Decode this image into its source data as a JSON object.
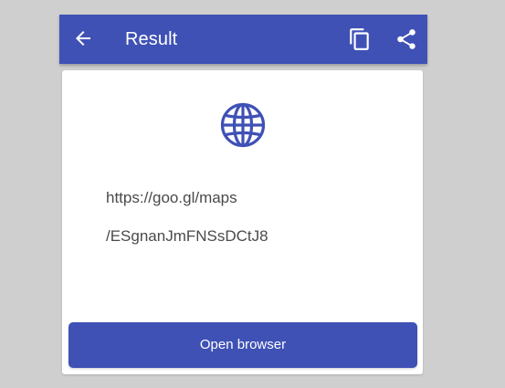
{
  "appbar": {
    "title": "Result",
    "back_icon": "arrow-back-icon",
    "copy_icon": "copy-icon",
    "share_icon": "share-icon",
    "color": "#3f51b5"
  },
  "result": {
    "type_icon": "globe-icon",
    "url_line1": "https://goo.gl/maps",
    "url_line2": "/ESgnanJmFNSsDCtJ8",
    "accent": "#3f51b5"
  },
  "actions": {
    "open_browser_label": "Open browser"
  }
}
